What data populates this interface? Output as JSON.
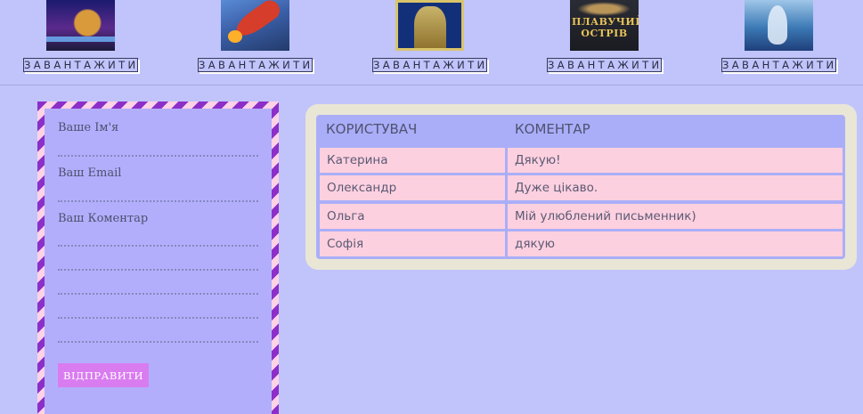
{
  "books": [
    {
      "cover_icon": "book-cover-1",
      "button_label": "ЗАВАНТАЖИТИ"
    },
    {
      "cover_icon": "book-cover-rocket",
      "button_label": "ЗАВАНТАЖИТИ"
    },
    {
      "cover_icon": "book-cover-ornate",
      "button_label": "ЗАВАНТАЖИТИ"
    },
    {
      "cover_icon": "book-cover-plavuchyi-ostriv",
      "cover_title": "ПЛАВУЧИЙ ОСТРІВ",
      "button_label": "ЗАВАНТАЖИТИ"
    },
    {
      "cover_icon": "book-cover-sea",
      "button_label": "ЗАВАНТАЖИТИ"
    }
  ],
  "form": {
    "name_label": "Ваше Ім'я",
    "email_label": "Ваш Email",
    "comment_label": "Ваш Коментар",
    "submit_label": "ВІДПРАВИТИ"
  },
  "table": {
    "headers": [
      "КОРИСТУВАЧ",
      "КОМЕНТАР"
    ],
    "rows": [
      {
        "user": "Катерина",
        "comment": "Дякую!"
      },
      {
        "user": "Олександр",
        "comment": "Дуже цікаво."
      },
      {
        "user": "Ольга",
        "comment": "Мій улюблений письменник)"
      },
      {
        "user": "Софія",
        "comment": "дякую"
      }
    ]
  },
  "colors": {
    "page_bg": "#c0c4fb",
    "form_stripe_dark": "#8c2fc9",
    "form_stripe_light": "#ffd3e6",
    "form_bg": "#b3aefc",
    "submit_bg": "#d97cf0",
    "table_frame": "#eae6d6",
    "table_header_bg": "#aaaef8",
    "table_cell_bg": "#fdd0df"
  }
}
